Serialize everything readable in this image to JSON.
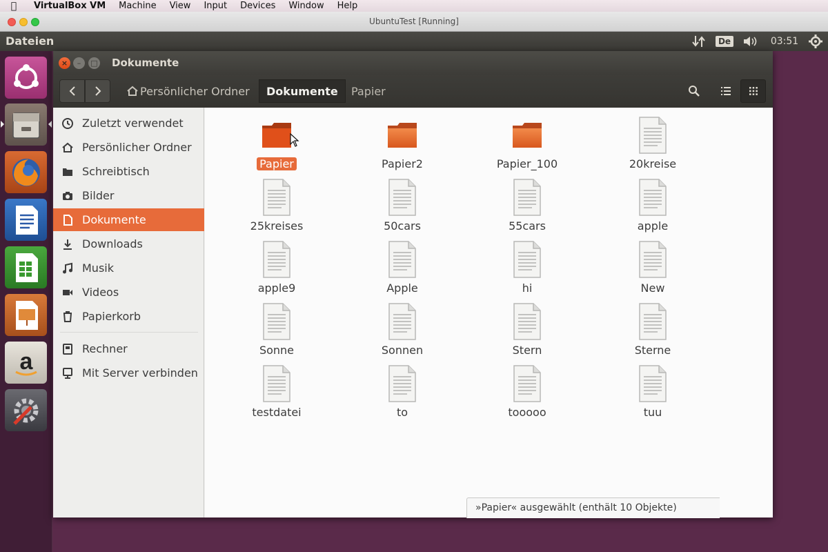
{
  "mac_menubar": {
    "items": [
      "VirtualBox VM",
      "Machine",
      "View",
      "Input",
      "Devices",
      "Window",
      "Help"
    ]
  },
  "vbox": {
    "title": "UbuntuTest [Running]"
  },
  "ubuntu_panel": {
    "app_name": "Dateien",
    "keyboard": "De",
    "time": "03:51"
  },
  "launcher": {
    "items": [
      {
        "icon": "ubuntu-dash-icon"
      },
      {
        "icon": "files-icon",
        "active": true
      },
      {
        "icon": "firefox-icon"
      },
      {
        "icon": "libreoffice-writer-icon"
      },
      {
        "icon": "libreoffice-calc-icon"
      },
      {
        "icon": "libreoffice-impress-icon"
      },
      {
        "icon": "amazon-icon"
      },
      {
        "icon": "system-settings-icon"
      }
    ]
  },
  "window": {
    "title": "Dokumente",
    "breadcrumbs": [
      "Persönlicher Ordner",
      "Dokumente",
      "Papier"
    ]
  },
  "sidebar": {
    "items": [
      {
        "label": "Zuletzt verwendet",
        "icon": "clock-icon"
      },
      {
        "label": "Persönlicher Ordner",
        "icon": "home-icon"
      },
      {
        "label": "Schreibtisch",
        "icon": "folder-icon"
      },
      {
        "label": "Bilder",
        "icon": "camera-icon"
      },
      {
        "label": "Dokumente",
        "icon": "document-icon",
        "active": true
      },
      {
        "label": "Downloads",
        "icon": "download-icon"
      },
      {
        "label": "Musik",
        "icon": "music-icon"
      },
      {
        "label": "Videos",
        "icon": "video-icon"
      },
      {
        "label": "Papierkorb",
        "icon": "trash-icon"
      },
      {
        "label": "Rechner",
        "icon": "computer-icon"
      },
      {
        "label": "Mit Server verbinden",
        "icon": "server-icon"
      }
    ]
  },
  "files": [
    {
      "name": "Papier",
      "type": "folder",
      "selected": true
    },
    {
      "name": "Papier2",
      "type": "folder"
    },
    {
      "name": "Papier_100",
      "type": "folder"
    },
    {
      "name": "20kreise",
      "type": "file"
    },
    {
      "name": "25kreises",
      "type": "file"
    },
    {
      "name": "50cars",
      "type": "file"
    },
    {
      "name": "55cars",
      "type": "file"
    },
    {
      "name": "apple",
      "type": "file"
    },
    {
      "name": "apple9",
      "type": "file"
    },
    {
      "name": "Apple",
      "type": "file"
    },
    {
      "name": "hi",
      "type": "file"
    },
    {
      "name": "New",
      "type": "file"
    },
    {
      "name": "Sonne",
      "type": "file"
    },
    {
      "name": "Sonnen",
      "type": "file"
    },
    {
      "name": "Stern",
      "type": "file"
    },
    {
      "name": "Sterne",
      "type": "file"
    },
    {
      "name": "testdatei",
      "type": "file"
    },
    {
      "name": "to",
      "type": "file"
    },
    {
      "name": "tooooo",
      "type": "file"
    },
    {
      "name": "tuu",
      "type": "file"
    }
  ],
  "status": "»Papier« ausgewählt  (enthält 10 Objekte)",
  "colors": {
    "accent": "#e76b3a",
    "panel": "#3c3b37",
    "launcher": "#3c1c32"
  }
}
